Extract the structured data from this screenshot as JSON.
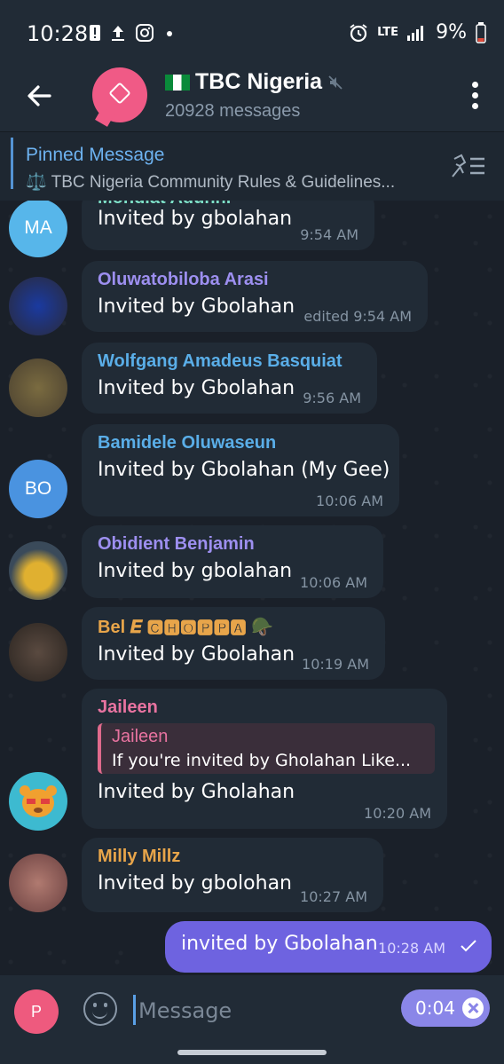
{
  "status": {
    "time": "10:28",
    "network": "LTE",
    "battery": "9%",
    "left_icons": [
      "alert-icon",
      "upload-icon",
      "instagram-icon",
      "dot-icon"
    ],
    "right_icons": [
      "alarm-icon",
      "signal-icon",
      "battery-icon"
    ]
  },
  "header": {
    "title": "TBC Nigeria",
    "flag": "nigeria-flag-icon",
    "subtitle": "20928 messages",
    "avatar_color": "#f05a86"
  },
  "pinned": {
    "label": "Pinned Message",
    "text": "⚖️ TBC  Nigeria Community Rules & Guidelines..."
  },
  "messages": [
    {
      "sender": "Mondiat Aduhni",
      "text": "Invited by gbolahan",
      "time": "9:54 AM",
      "initials": "MA",
      "sender_color": "#7ee0c8",
      "avatar_color": "#57b6ea"
    },
    {
      "sender": "Oluwatobiloba Arasi",
      "text": "Invited by Gbolahan",
      "time": "edited 9:54 AM",
      "initials": "",
      "sender_color": "#9d8ff0",
      "avatar_color": "#2a3a8c"
    },
    {
      "sender": "Wolfgang Amadeus Basquiat",
      "text": "Invited by Gbolahan",
      "time": "9:56 AM",
      "initials": "",
      "sender_color": "#5aaee8",
      "avatar_color": "#6b5d3a"
    },
    {
      "sender": "Bamidele Oluwaseun",
      "text": "Invited by Gbolahan (My Gee)",
      "time": "10:06 AM",
      "initials": "BO",
      "sender_color": "#5aaee8",
      "avatar_color": "#4a93e0"
    },
    {
      "sender": "Obidient Benjamin",
      "text": "Invited by gbolahan",
      "time": "10:06 AM",
      "initials": "",
      "sender_color": "#9d8ff0",
      "avatar_color": "#c9a13a"
    },
    {
      "sender": "Bel 𝑬 🅲🅷🅾🅿🅿🅰 🪖",
      "text": "Invited by Gbolahan",
      "time": "10:19 AM",
      "initials": "",
      "sender_color": "#e8a54a",
      "avatar_color": "#3a3430"
    },
    {
      "sender": "Jaileen",
      "text": "Invited by Gholahan",
      "time": "10:20 AM",
      "initials": "",
      "sender_color": "#e873a0",
      "avatar_color": "#3dbad0",
      "reply_name": "Jaileen",
      "reply_text": "If you're invited by Gholahan  Like..."
    },
    {
      "sender": "Milly Millz",
      "text": "Invited by gbolohan",
      "time": "10:27 AM",
      "initials": "",
      "sender_color": "#e8a54a",
      "avatar_color": "#8a6060"
    }
  ],
  "own_message": {
    "text": "invited by Gbolahan",
    "time": "10:28 AM"
  },
  "input": {
    "placeholder": "Message",
    "avatar_initial": "P",
    "recording_time": "0:04"
  }
}
